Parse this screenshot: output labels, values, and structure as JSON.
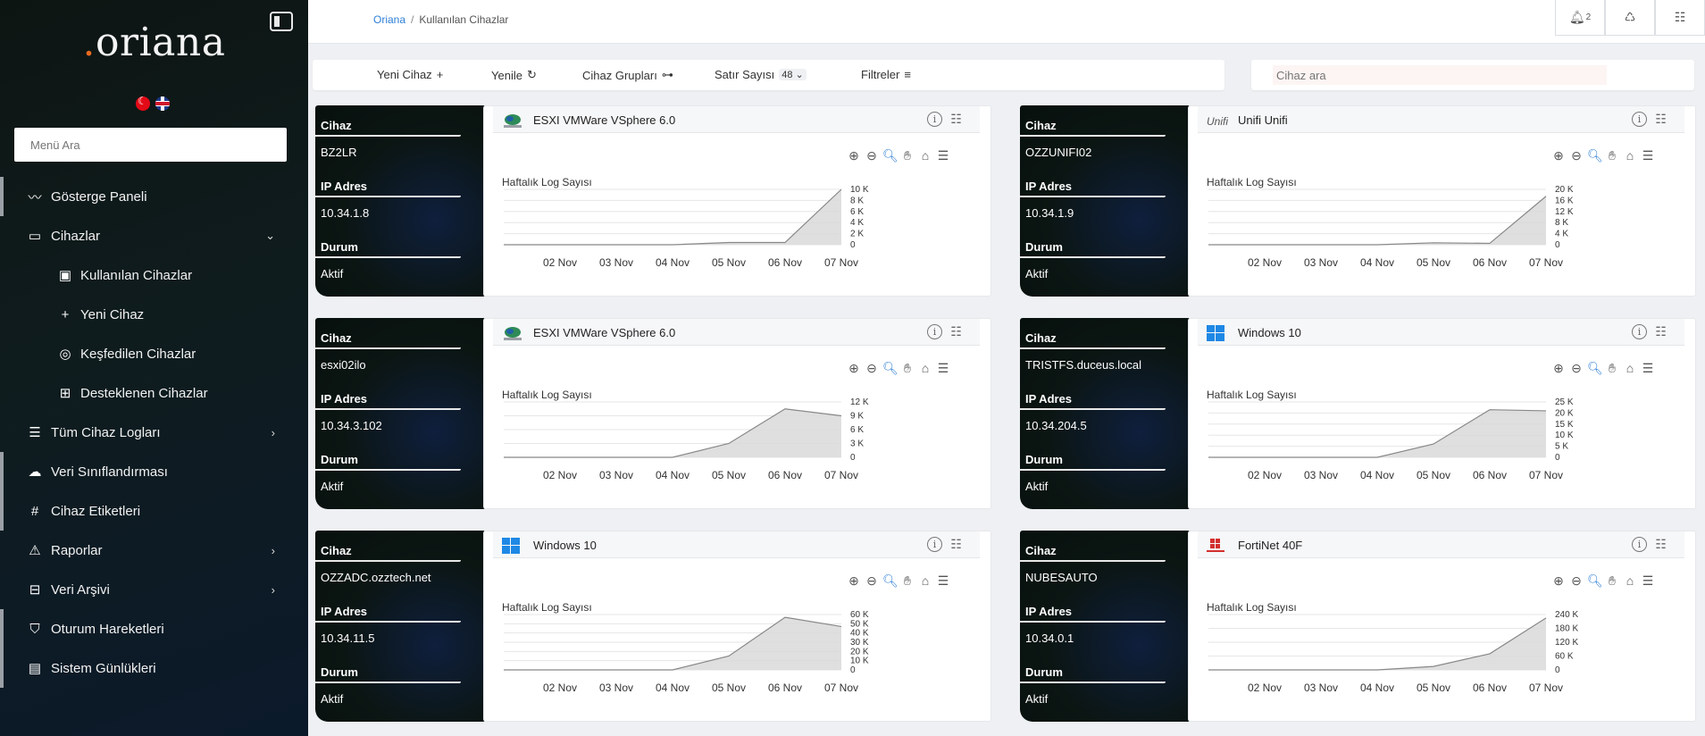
{
  "app": {
    "logo_dot": ".",
    "logo_text": "oriana"
  },
  "sidebar": {
    "search_placeholder": "Menü Ara",
    "items": [
      {
        "label": "Gösterge Paneli",
        "icon": "dashboard-icon",
        "level": "main"
      },
      {
        "label": "Cihazlar",
        "icon": "devices-icon",
        "level": "main",
        "chevron": "down"
      },
      {
        "label": "Kullanılan Cihazlar",
        "icon": "used-devices-icon",
        "level": "sub"
      },
      {
        "label": "Yeni Cihaz",
        "icon": "plus-icon",
        "level": "sub"
      },
      {
        "label": "Keşfedilen Cihazlar",
        "icon": "discover-icon",
        "level": "sub"
      },
      {
        "label": "Desteklenen Cihazlar",
        "icon": "supported-devices-icon",
        "level": "sub"
      },
      {
        "label": "Tüm Cihaz Logları",
        "icon": "logs-icon",
        "level": "main",
        "chevron": "right"
      },
      {
        "label": "Veri Sınıflandırması",
        "icon": "classification-icon",
        "level": "main"
      },
      {
        "label": "Cihaz Etiketleri",
        "icon": "hash-icon",
        "level": "main"
      },
      {
        "label": "Raporlar",
        "icon": "warning-icon",
        "level": "main",
        "chevron": "right"
      },
      {
        "label": "Veri Arşivi",
        "icon": "archive-icon",
        "level": "main",
        "chevron": "right"
      },
      {
        "label": "Oturum Hareketleri",
        "icon": "shield-icon",
        "level": "main"
      },
      {
        "label": "Sistem Günlükleri",
        "icon": "system-log-icon",
        "level": "main"
      }
    ]
  },
  "topbar": {
    "breadcrumb_root": "Oriana",
    "breadcrumb_sep": "/",
    "breadcrumb_current": "Kullanılan Cihazlar",
    "notification_count": "2"
  },
  "toolbar": {
    "new_device": "Yeni Cihaz",
    "refresh": "Yenile",
    "device_groups": "Cihaz Grupları",
    "row_count_label": "Satır Sayısı",
    "row_count_value": "48",
    "filters": "Filtreler",
    "search_placeholder": "Cihaz ara"
  },
  "colors": {
    "accent": "#2f7fd6",
    "logo_dot": "#e8691f",
    "area_fill": "#d9d9d9",
    "area_line": "#888888"
  },
  "cards": [
    {
      "device_label": "Cihaz",
      "device": "BZ2LR",
      "ip_label": "IP Adres",
      "ip": "10.34.1.8",
      "status_label": "Durum",
      "status": "Aktif",
      "title": "ESXI VMWare VSphere 6.0",
      "logo": "vmware",
      "chart_subtitle": "Haftalık Log Sayısı",
      "chart_data": {
        "type": "area",
        "categories": [
          "02 Nov",
          "03 Nov",
          "04 Nov",
          "05 Nov",
          "06 Nov",
          "07 Nov"
        ],
        "x": [
          0,
          1,
          2,
          3,
          4,
          5,
          6
        ],
        "values": [
          0,
          0,
          0,
          0,
          400,
          400,
          10000
        ],
        "yticks": [
          "10 K",
          "8 K",
          "6 K",
          "4 K",
          "2 K",
          "0"
        ],
        "ylim": [
          0,
          10000
        ]
      }
    },
    {
      "device_label": "Cihaz",
      "device": "OZZUNIFI02",
      "ip_label": "IP Adres",
      "ip": "10.34.1.9",
      "status_label": "Durum",
      "status": "Aktif",
      "title": "Unifi Unifi",
      "logo": "unifi",
      "chart_subtitle": "Haftalık Log Sayısı",
      "chart_data": {
        "type": "area",
        "categories": [
          "02 Nov",
          "03 Nov",
          "04 Nov",
          "05 Nov",
          "06 Nov",
          "07 Nov"
        ],
        "x": [
          0,
          1,
          2,
          3,
          4,
          5,
          6
        ],
        "values": [
          0,
          0,
          0,
          0,
          700,
          500,
          17500
        ],
        "yticks": [
          "20 K",
          "16 K",
          "12 K",
          "8 K",
          "4 K",
          "0"
        ],
        "ylim": [
          0,
          20000
        ]
      }
    },
    {
      "device_label": "Cihaz",
      "device": "esxi02ilo",
      "ip_label": "IP Adres",
      "ip": "10.34.3.102",
      "status_label": "Durum",
      "status": "Aktif",
      "title": "ESXI VMWare VSphere 6.0",
      "logo": "vmware",
      "chart_subtitle": "Haftalık Log Sayısı",
      "chart_data": {
        "type": "area",
        "categories": [
          "02 Nov",
          "03 Nov",
          "04 Nov",
          "05 Nov",
          "06 Nov",
          "07 Nov"
        ],
        "x": [
          0,
          1,
          2,
          3,
          4,
          5,
          6
        ],
        "values": [
          0,
          0,
          0,
          0,
          3000,
          10500,
          9000
        ],
        "yticks": [
          "12 K",
          "9 K",
          "6 K",
          "3 K",
          "0"
        ],
        "ylim": [
          0,
          12000
        ]
      }
    },
    {
      "device_label": "Cihaz",
      "device": "TRISTFS.duceus.local",
      "ip_label": "IP Adres",
      "ip": "10.34.204.5",
      "status_label": "Durum",
      "status": "Aktif",
      "title": "Windows 10",
      "logo": "windows",
      "chart_subtitle": "Haftalık Log Sayısı",
      "chart_data": {
        "type": "area",
        "categories": [
          "02 Nov",
          "03 Nov",
          "04 Nov",
          "05 Nov",
          "06 Nov",
          "07 Nov"
        ],
        "x": [
          0,
          1,
          2,
          3,
          4,
          5,
          6
        ],
        "values": [
          0,
          0,
          0,
          0,
          6000,
          21500,
          21000
        ],
        "yticks": [
          "25 K",
          "20 K",
          "15 K",
          "10 K",
          "5 K",
          "0"
        ],
        "ylim": [
          0,
          25000
        ]
      }
    },
    {
      "device_label": "Cihaz",
      "device": "OZZADC.ozztech.net",
      "ip_label": "IP Adres",
      "ip": "10.34.11.5",
      "status_label": "Durum",
      "status": "Aktif",
      "title": "Windows 10",
      "logo": "windows",
      "chart_subtitle": "Haftalık Log Sayısı",
      "chart_data": {
        "type": "area",
        "categories": [
          "02 Nov",
          "03 Nov",
          "04 Nov",
          "05 Nov",
          "06 Nov",
          "07 Nov"
        ],
        "x": [
          0,
          1,
          2,
          3,
          4,
          5,
          6
        ],
        "values": [
          0,
          0,
          0,
          0,
          15000,
          57000,
          47000
        ],
        "yticks": [
          "60 K",
          "50 K",
          "40 K",
          "30 K",
          "20 K",
          "10 K",
          "0"
        ],
        "ylim": [
          0,
          60000
        ]
      }
    },
    {
      "device_label": "Cihaz",
      "device": "NUBESAUTO",
      "ip_label": "IP Adres",
      "ip": "10.34.0.1",
      "status_label": "Durum",
      "status": "Aktif",
      "title": "FortiNet 40F",
      "logo": "fortinet",
      "chart_subtitle": "Haftalık Log Sayısı",
      "chart_data": {
        "type": "area",
        "categories": [
          "02 Nov",
          "03 Nov",
          "04 Nov",
          "05 Nov",
          "06 Nov",
          "07 Nov"
        ],
        "x": [
          0,
          1,
          2,
          3,
          4,
          5,
          6
        ],
        "values": [
          0,
          0,
          0,
          0,
          15000,
          70000,
          225000
        ],
        "yticks": [
          "240 K",
          "180 K",
          "120 K",
          "60 K",
          "0"
        ],
        "ylim": [
          0,
          240000
        ]
      }
    }
  ]
}
